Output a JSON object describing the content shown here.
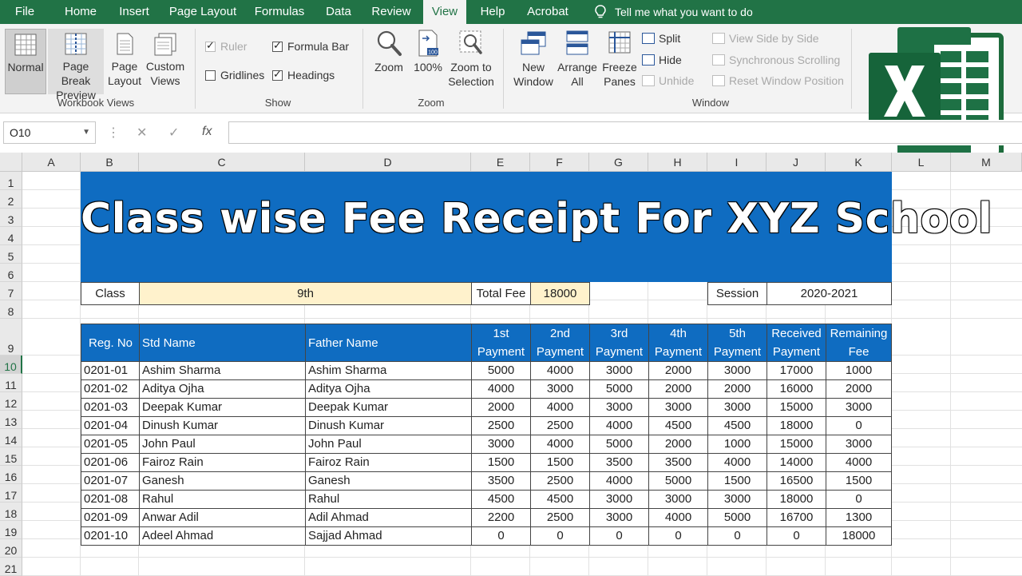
{
  "tabs": [
    {
      "label": "File"
    },
    {
      "label": "Home"
    },
    {
      "label": "Insert"
    },
    {
      "label": "Page Layout"
    },
    {
      "label": "Formulas"
    },
    {
      "label": "Data"
    },
    {
      "label": "Review"
    },
    {
      "label": "View"
    },
    {
      "label": "Help"
    },
    {
      "label": "Acrobat"
    }
  ],
  "tell_me": "Tell me what you want to do",
  "ribbon": {
    "workbook_views": {
      "label": "Workbook Views",
      "normal": "Normal",
      "page_break_1": "Page Break",
      "page_break_2": "Preview",
      "page_layout_1": "Page",
      "page_layout_2": "Layout",
      "custom_views_1": "Custom",
      "custom_views_2": "Views"
    },
    "show": {
      "label": "Show",
      "ruler": "Ruler",
      "formula_bar": "Formula Bar",
      "gridlines": "Gridlines",
      "headings": "Headings"
    },
    "zoom": {
      "label": "Zoom",
      "zoom": "Zoom",
      "hundred": "100%",
      "zoom_sel_1": "Zoom to",
      "zoom_sel_2": "Selection"
    },
    "window": {
      "label": "Window",
      "new_1": "New",
      "new_2": "Window",
      "arrange_1": "Arrange",
      "arrange_2": "All",
      "freeze_1": "Freeze",
      "freeze_2": "Panes",
      "split": "Split",
      "hide": "Hide",
      "unhide": "Unhide",
      "side_by_side": "View Side by Side",
      "sync_scroll": "Synchronous Scrolling",
      "reset_pos": "Reset Window Position"
    }
  },
  "name_box": "O10",
  "formula_symbols": {
    "cancel": "✕",
    "enter": "✓",
    "fx": "fx"
  },
  "columns": [
    "A",
    "B",
    "C",
    "D",
    "E",
    "F",
    "G",
    "H",
    "I",
    "J",
    "K",
    "L",
    "M"
  ],
  "rows": [
    "1",
    "2",
    "3",
    "4",
    "5",
    "6",
    "7",
    "8",
    "9",
    "10",
    "11",
    "12",
    "13",
    "14",
    "15",
    "16",
    "17",
    "18",
    "19",
    "20",
    "21"
  ],
  "sheet": {
    "title": "Class wise Fee Receipt For XYZ School",
    "class_label": "Class",
    "class_value": "9th",
    "total_fee_label": "Total Fee",
    "total_fee_value": "18000",
    "session_label": "Session",
    "session_value": "2020-2021",
    "headers": {
      "reg": "Reg. No",
      "std": "Std Name",
      "father": "Father Name",
      "p1a": "1st",
      "p1b": "Payment",
      "p2a": "2nd",
      "p2b": "Payment",
      "p3a": "3rd",
      "p3b": "Payment",
      "p4a": "4th",
      "p4b": "Payment",
      "p5a": "5th",
      "p5b": "Payment",
      "reca": "Received",
      "recb": "Payment",
      "rema": "Remaining",
      "remb": "Fee"
    },
    "records": [
      [
        "0201-01",
        "Ashim Sharma",
        "Ashim Sharma",
        "5000",
        "4000",
        "3000",
        "2000",
        "3000",
        "17000",
        "1000"
      ],
      [
        "0201-02",
        "Aditya Ojha",
        "Aditya Ojha",
        "4000",
        "3000",
        "5000",
        "2000",
        "2000",
        "16000",
        "2000"
      ],
      [
        "0201-03",
        "Deepak Kumar",
        "Deepak Kumar",
        "2000",
        "4000",
        "3000",
        "3000",
        "3000",
        "15000",
        "3000"
      ],
      [
        "0201-04",
        "Dinush Kumar",
        "Dinush Kumar",
        "2500",
        "2500",
        "4000",
        "4500",
        "4500",
        "18000",
        "0"
      ],
      [
        "0201-05",
        "John Paul",
        "John Paul",
        "3000",
        "4000",
        "5000",
        "2000",
        "1000",
        "15000",
        "3000"
      ],
      [
        "0201-06",
        "Fairoz Rain",
        "Fairoz Rain",
        "1500",
        "1500",
        "3500",
        "3500",
        "4000",
        "14000",
        "4000"
      ],
      [
        "0201-07",
        "Ganesh",
        "Ganesh",
        "3500",
        "2500",
        "4000",
        "5000",
        "1500",
        "16500",
        "1500"
      ],
      [
        "0201-08",
        "Rahul",
        "Rahul",
        "4500",
        "4500",
        "3000",
        "3000",
        "3000",
        "18000",
        "0"
      ],
      [
        "0201-09",
        "Anwar Adil",
        "Adil Ahmad",
        "2200",
        "2500",
        "3000",
        "4000",
        "5000",
        "16700",
        "1300"
      ],
      [
        "0201-10",
        "Adeel Ahmad",
        "Sajjad Ahmad",
        "0",
        "0",
        "0",
        "0",
        "0",
        "0",
        "18000"
      ]
    ]
  },
  "colors": {
    "excel_green": "#217346",
    "banner_blue": "#0f6cc1",
    "cream": "#fff2cc"
  }
}
